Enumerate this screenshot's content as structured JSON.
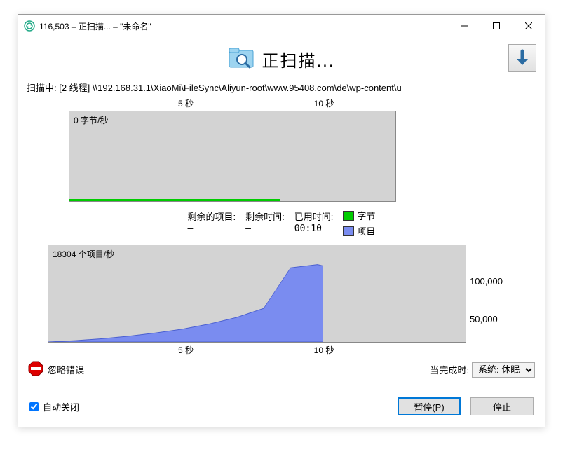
{
  "window": {
    "title": "116,503 – 正扫描... – \"未命名\""
  },
  "header": {
    "scan_title": "正扫描..."
  },
  "path": {
    "text": "扫描中: [2 线程] \\\\192.168.31.1\\XiaoMi\\FileSync\\Aliyun-root\\www.95408.com\\de\\wp-content\\u"
  },
  "axis": {
    "top_5s": "5 秒",
    "top_10s": "10 秒",
    "bot_5s": "5 秒",
    "bot_10s": "10 秒",
    "y_100k": "100,000",
    "y_50k": "50,000"
  },
  "chart1": {
    "label": "0 字节/秒"
  },
  "stats": {
    "remaining_items_label": "剩余的项目:",
    "remaining_items_value": "–",
    "remaining_time_label": "剩余时间:",
    "remaining_time_value": "–",
    "elapsed_label": "已用时间:",
    "elapsed_value": "00:10"
  },
  "legend": {
    "bytes": "字节",
    "items": "项目",
    "bytes_color": "#00cc00",
    "items_color": "#7a8cf0"
  },
  "chart2": {
    "label": "18304 个项目/秒"
  },
  "options": {
    "ignore_errors": "忽略错误",
    "on_complete_label": "当完成时:",
    "on_complete_value": "系统: 休眠"
  },
  "footer": {
    "auto_close": "自动关闭",
    "pause": "暂停(P)",
    "stop": "停止"
  },
  "chart_data": [
    {
      "type": "area",
      "title": "0 字节/秒",
      "xlabel": "秒",
      "ylabel": "字节/秒",
      "x": [
        0,
        1,
        2,
        3,
        4,
        5,
        6,
        7,
        8,
        9,
        10
      ],
      "series": [
        {
          "name": "字节",
          "values": [
            0,
            0,
            0,
            0,
            0,
            0,
            0,
            0,
            0,
            0,
            0
          ]
        }
      ],
      "xlim": [
        0,
        15.5
      ],
      "ylim": [
        0,
        1
      ]
    },
    {
      "type": "area",
      "title": "18304 个项目/秒",
      "xlabel": "秒",
      "ylabel": "项目/秒",
      "x": [
        0,
        1,
        2,
        3,
        4,
        5,
        6,
        7,
        8,
        9,
        10,
        10.2
      ],
      "series": [
        {
          "name": "项目",
          "values": [
            0,
            2000,
            5000,
            9000,
            14000,
            20000,
            28000,
            38000,
            52000,
            115000,
            120000,
            118000
          ]
        }
      ],
      "xlim": [
        0,
        15.5
      ],
      "ylim": [
        0,
        150000
      ],
      "yticks": [
        50000,
        100000
      ]
    }
  ]
}
